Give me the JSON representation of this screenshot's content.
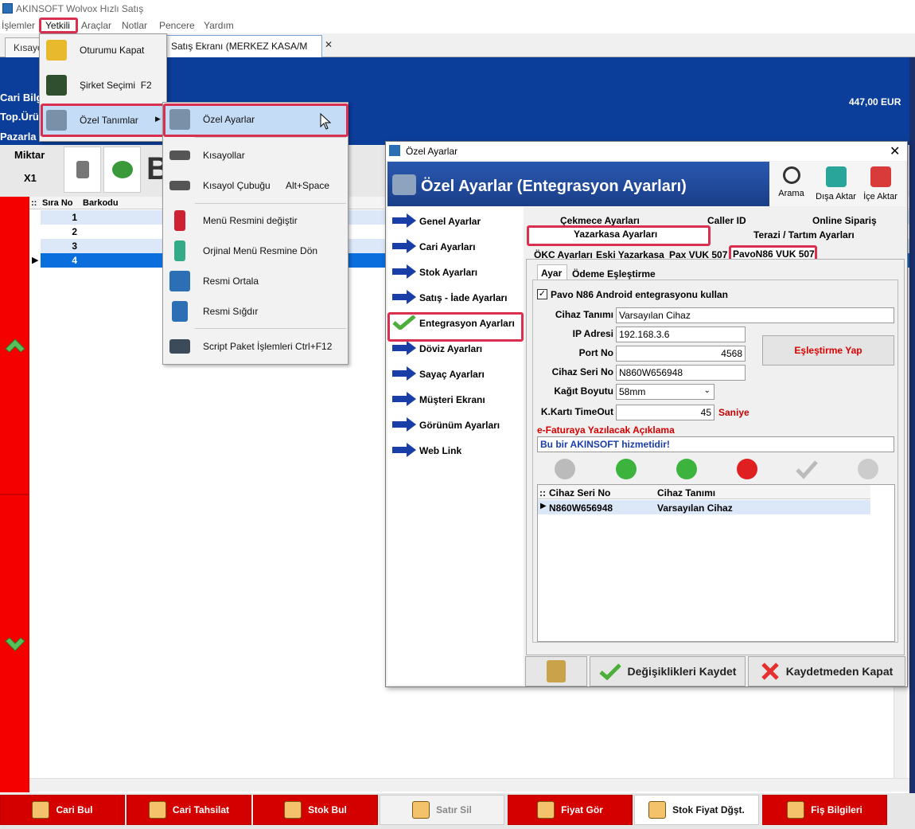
{
  "app": {
    "title": "AKINSOFT Wolvox Hızlı Satış"
  },
  "menubar": [
    "İşlemler",
    "Yetkili",
    "Araçlar",
    "Notlar",
    "Pencere",
    "Yardım"
  ],
  "tabs": {
    "shortcut_tab": "Kısayo",
    "active_tab": "Satış Ekranı (MERKEZ KASA/M"
  },
  "main": {
    "cari_label": "Cari Bilg",
    "top_label": "Top.Ürü",
    "pazarlama_label": "Pazarla",
    "total": "447,00 EUR",
    "miktar_label": "Miktar",
    "miktar_value": "X1",
    "b_letter": "B",
    "grid_headers": [
      "Sıra No",
      "Barkodu"
    ],
    "grid_rows": [
      "1",
      "2",
      "3",
      "4"
    ]
  },
  "menu_yetkili": [
    {
      "label": "Oturumu Kapat",
      "shortcut": ""
    },
    {
      "label": "Şirket Seçimi",
      "shortcut": "F2"
    },
    {
      "label": "Özel Tanımlar",
      "shortcut": ""
    }
  ],
  "submenu": [
    {
      "label": "Özel Ayarlar",
      "shortcut": ""
    },
    {
      "label": "Kısayollar",
      "shortcut": ""
    },
    {
      "label": "Kısayol Çubuğu",
      "shortcut": "Alt+Space"
    },
    {
      "label": "Menü Resmini değiştir",
      "shortcut": ""
    },
    {
      "label": "Orjinal Menü Resmine Dön",
      "shortcut": ""
    },
    {
      "label": "Resmi Ortala",
      "shortcut": ""
    },
    {
      "label": "Resmi Sığdır",
      "shortcut": ""
    },
    {
      "label": "Script Paket İşlemleri",
      "shortcut": "Ctrl+F12"
    }
  ],
  "dialog": {
    "title": "Özel Ayarlar",
    "header": "Özel Ayarlar (Entegrasyon Ayarları)",
    "toolbar": [
      "Arama",
      "Dışa Aktar",
      "İçe Aktar"
    ],
    "nav": [
      "Genel Ayarlar",
      "Cari Ayarları",
      "Stok Ayarları",
      "Satış - İade Ayarları",
      "Entegrasyon Ayarları",
      "Döviz Ayarları",
      "Sayaç Ayarları",
      "Müşteri Ekranı",
      "Görünüm Ayarları",
      "Web Link"
    ],
    "tabs_row1": [
      "Çekmece Ayarları",
      "Caller ID",
      "Online Sipariş"
    ],
    "tabs_row2": [
      "Yazarkasa Ayarları",
      "Terazi / Tartım Ayarları"
    ],
    "tabs_row3": [
      "ÖKC Ayarları",
      "Eski Yazarkasa",
      "Pax VUK 507",
      "PavoN86 VUK 507"
    ],
    "tabs_row4": [
      "Ayar",
      "Ödeme Eşleştirme"
    ],
    "checkbox_label": "Pavo N86 Android entegrasyonu kullan",
    "fields": {
      "cihaz_tanimi_label": "Cihaz Tanımı",
      "cihaz_tanimi": "Varsayılan Cihaz",
      "ip_label": "IP Adresi",
      "ip": "192.168.3.6",
      "port_label": "Port No",
      "port": "4568",
      "seri_label": "Cihaz Seri No",
      "seri": "N860W656948",
      "kagit_label": "Kağıt Boyutu",
      "kagit": "58mm",
      "timeout_label": "K.Kartı TimeOut",
      "timeout": "45",
      "timeout_unit": "Saniye"
    },
    "eslestir_button": "Eşleştirme Yap",
    "efatura_label": "e-Faturaya Yazılacak Açıklama",
    "efatura_value": "Bu bir AKINSOFT hizmetidir!",
    "pair_headers": [
      "Cihaz Seri No",
      "Cihaz Tanımı"
    ],
    "pair_rows": [
      {
        "seri": "N860W656948",
        "tanim": "Varsayılan Cihaz"
      }
    ],
    "save_button": "Değişiklikleri Kaydet",
    "close_button": "Kaydetmeden Kapat"
  },
  "bottom": [
    "Cari Bul",
    "Cari Tahsilat",
    "Stok Bul",
    "Satır Sil",
    "Fiyat Gör",
    "Stok Fiyat Dğşt.",
    "Fiş Bilgileri"
  ]
}
